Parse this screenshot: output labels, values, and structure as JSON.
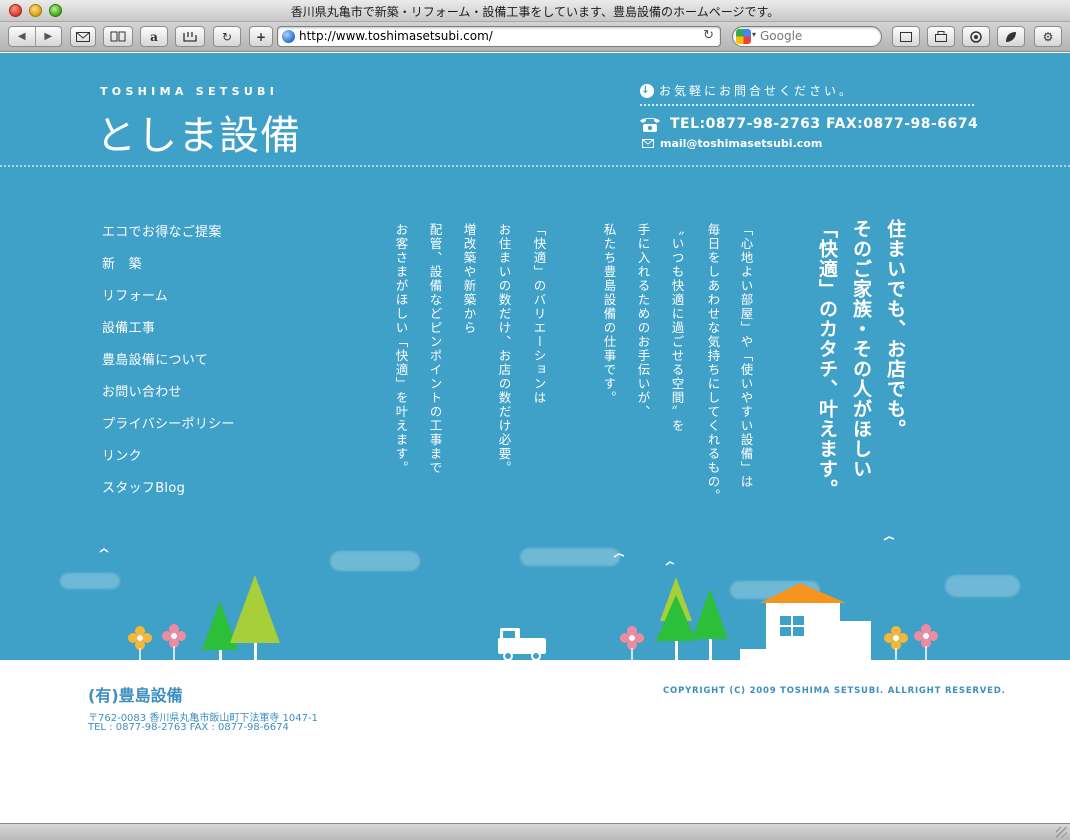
{
  "browser": {
    "window_title": "香川県丸亀市で新築・リフォーム・設備工事をしています、豊島設備のホームページです。",
    "url": "http://www.toshimasetsubi.com/",
    "search_placeholder": "Google",
    "toolbar_icons": [
      "back-icon",
      "forward-icon",
      "mail-icon",
      "bookmarks-icon",
      "amazon-icon",
      "kanji-icon",
      "reload-icon",
      "add-bookmark-icon",
      "window-icon",
      "tab-icon",
      "activity-icon",
      "leaf-icon",
      "gear-icon"
    ]
  },
  "header": {
    "brand_en": "TOSHIMA SETSUBI",
    "brand_jp": "としま設備",
    "contact_prompt": "お気軽にお問合せください。",
    "tel_fax": "TEL:0877-98-2763  FAX:0877-98-6674",
    "email": "mail@toshimasetsubi.com"
  },
  "nav": {
    "items": [
      "エコでお得なご提案",
      "新　築",
      "リフォーム",
      "設備工事",
      "豊島設備について",
      "お問い合わせ",
      "プライバシーポリシー",
      "リンク",
      "スタッフBlog"
    ]
  },
  "message": {
    "lead": [
      "住まいでも、お店でも。",
      "そのご家族・その人がほしい",
      "「快適」のカタチ、叶えます。"
    ],
    "body": [
      "「心地よい部屋」や「使いやすい設備」は",
      "毎日をしあわせな気持ちにしてくれるもの。",
      "〝いつも快適に過ごせる空間〟を",
      "手に入れるためのお手伝いが、",
      "私たち豊島設備の仕事です。",
      "「快適」のバリエーションは",
      "お住まいの数だけ、お店の数だけ必要。",
      "増改築や新築から",
      "配管、設備などピンポイントの工事まで",
      "お客さまがほしい「快適」を叶えます。"
    ]
  },
  "footer": {
    "company": "(有)豊島設備",
    "address": "〒762-0083 香川県丸亀市飯山町下法軍寺 1047-1",
    "tel_fax": "TEL : 0877-98-2763 FAX : 0877-98-6674",
    "copyright": "COPYRIGHT (C) 2009 TOSHIMA SETSUBI. ALLRIGHT RESERVED."
  }
}
